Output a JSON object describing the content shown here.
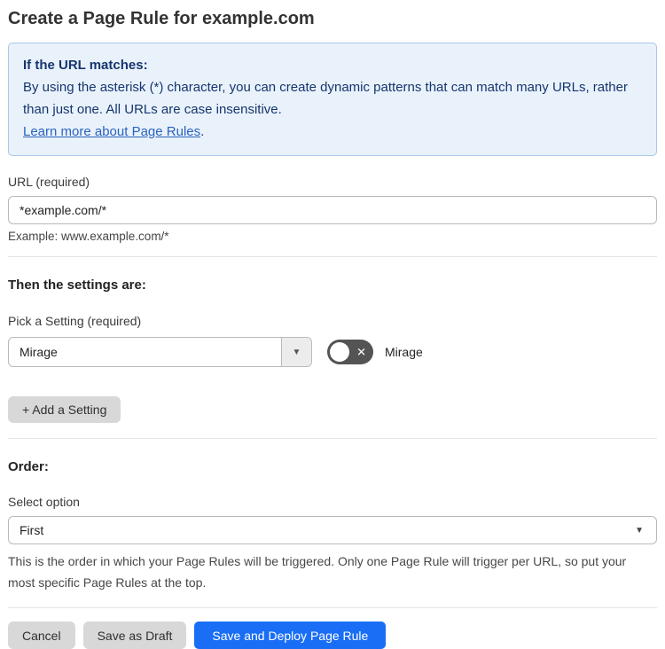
{
  "page": {
    "title": "Create a Page Rule for example.com"
  },
  "info_box": {
    "heading": "If the URL matches:",
    "body": "By using the asterisk (*) character, you can create dynamic patterns that can match many URLs, rather than just one. All URLs are case insensitive.",
    "link_label": "Learn more about Page Rules",
    "link_suffix": "."
  },
  "url_field": {
    "label": "URL (required)",
    "value": "*example.com/*",
    "helper": "Example: www.example.com/*"
  },
  "settings_section": {
    "heading": "Then the settings are:",
    "picker_label": "Pick a Setting (required)",
    "picker_value": "Mirage",
    "picker_arrow": "▼",
    "toggle_state": "off",
    "toggle_x": "✕",
    "toggle_label": "Mirage",
    "add_button_label": "+ Add a Setting"
  },
  "order_section": {
    "heading": "Order:",
    "select_label": "Select option",
    "select_value": "First",
    "select_arrow": "▼",
    "helper": "This is the order in which your Page Rules will be triggered. Only one Page Rule will trigger per URL, so put your most specific Page Rules at the top."
  },
  "actions": {
    "cancel": "Cancel",
    "save_draft": "Save as Draft",
    "save_deploy": "Save and Deploy Page Rule"
  },
  "colors": {
    "accent_blue": "#1a6ef5",
    "info_bg": "#e9f2fb",
    "info_border": "#a9c7e8",
    "info_text": "#16356e",
    "link_blue": "#2a63be",
    "button_gray": "#d8d8d8",
    "toggle_gray": "#545454"
  }
}
